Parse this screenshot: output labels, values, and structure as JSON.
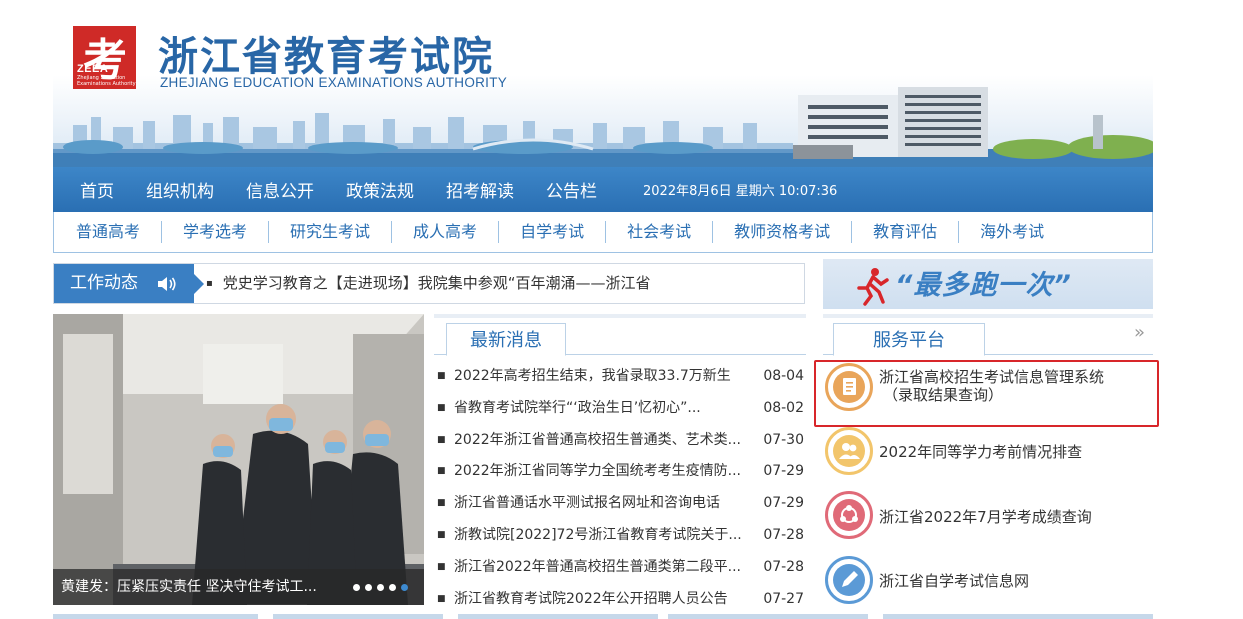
{
  "header": {
    "logo_glyph": "考",
    "logo_abbr": "ZEEA",
    "logo_sub": "Zhejiang Education Examinations Authority",
    "title": "浙江省教育考试院",
    "subtitle": "ZHEJIANG EDUCATION EXAMINATIONS AUTHORITY"
  },
  "main_nav": {
    "items": [
      "首页",
      "组织机构",
      "信息公开",
      "政策法规",
      "招考解读",
      "公告栏"
    ],
    "datetime": "2022年8月6日 星期六 10:07:36"
  },
  "sub_nav": {
    "items": [
      "普通高考",
      "学考选考",
      "研究生考试",
      "成人高考",
      "自学考试",
      "社会考试",
      "教师资格考试",
      "教育评估",
      "海外考试"
    ]
  },
  "work": {
    "tag": "工作动态",
    "ticker": "党史学习教育之【走进现场】我院集中参观“百年潮涌——浙江省"
  },
  "photo": {
    "caption": "黄建发：压紧压实责任 坚决守住考试工...",
    "dots": 5,
    "active_dot": 5
  },
  "news": {
    "tab": "最新消息",
    "items": [
      {
        "title": "2022年高考招生结束，我省录取33.7万新生",
        "date": "08-04"
      },
      {
        "title": "省教育考试院举行“‘政治生日’忆初心”...",
        "date": "08-02"
      },
      {
        "title": "2022年浙江省普通高校招生普通类、艺术类...",
        "date": "07-30"
      },
      {
        "title": "2022年浙江省同等学力全国统考考生疫情防...",
        "date": "07-29"
      },
      {
        "title": "浙江省普通话水平测试报名网址和咨询电话",
        "date": "07-29"
      },
      {
        "title": "浙教试院[2022]72号浙江省教育考试院关于...",
        "date": "07-28"
      },
      {
        "title": "浙江省2022年普通高校招生普通类第二段平...",
        "date": "07-28"
      },
      {
        "title": "浙江省教育考试院2022年公开招聘人员公告",
        "date": "07-27"
      }
    ]
  },
  "run_banner": {
    "text": "“最多跑一次”"
  },
  "service": {
    "tab": "服务平台",
    "more": "»",
    "items": [
      {
        "line1": "浙江省高校招生考试信息管理系统",
        "line2": "（录取结果查询）",
        "icon": "document-icon",
        "color": "#e9a55a"
      },
      {
        "line1": "2022年同等学力考前情况排查",
        "line2": "",
        "icon": "users-icon",
        "color": "#f2c56b"
      },
      {
        "line1": "浙江省2022年7月学考成绩查询",
        "line2": "",
        "icon": "share-icon",
        "color": "#e06a78"
      },
      {
        "line1": "浙江省自学考试信息网",
        "line2": "",
        "icon": "pencil-icon",
        "color": "#5b9ad6"
      }
    ]
  },
  "colors": {
    "brand_blue": "#2a6fb3",
    "logo_red": "#cf2a27",
    "highlight_red": "#d8262a"
  }
}
